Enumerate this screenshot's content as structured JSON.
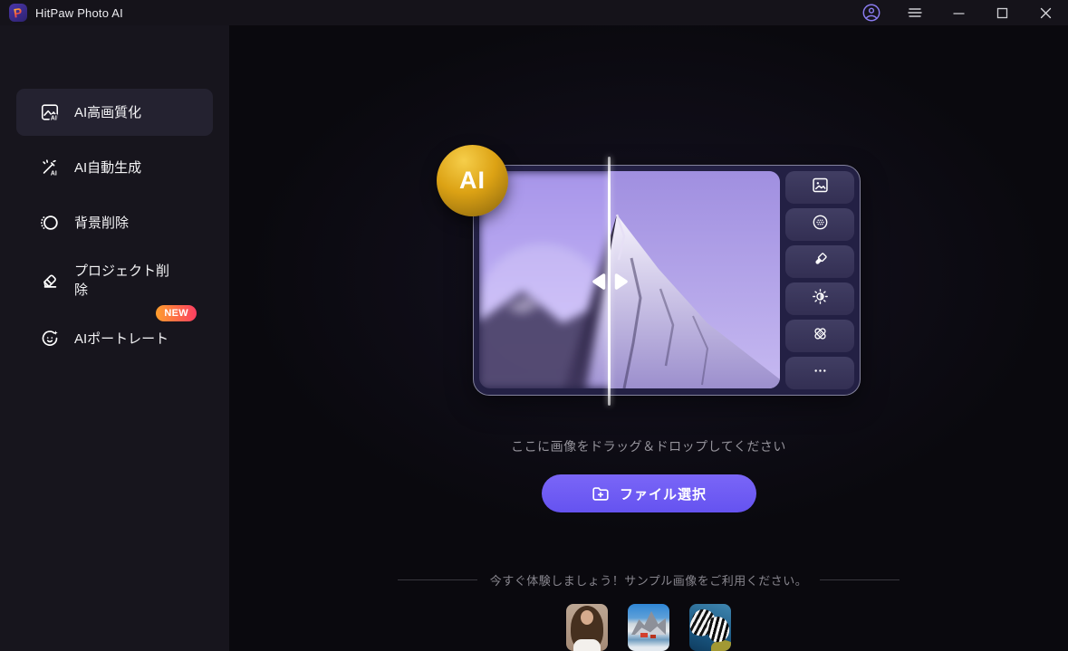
{
  "titlebar": {
    "app_title": "HitPaw Photo AI",
    "logo_letter": "P",
    "controls": [
      "account-icon",
      "menu-icon",
      "minimize",
      "maximize",
      "close"
    ]
  },
  "sidebar": {
    "items": [
      {
        "label": "AI高画質化",
        "icon": "ai-enhance-icon",
        "selected": true
      },
      {
        "label": "AI自動生成",
        "icon": "ai-generate-icon",
        "selected": false
      },
      {
        "label": "背景削除",
        "icon": "background-removal-icon",
        "selected": false
      },
      {
        "label": "プロジェクト削除",
        "icon": "object-eraser-icon",
        "selected": false
      },
      {
        "label": "AIポートレート",
        "icon": "ai-portrait-icon",
        "selected": false,
        "badge": "NEW"
      }
    ]
  },
  "main": {
    "hero": {
      "ai_badge_label": "AI",
      "toolbar_icons": [
        "image-icon",
        "denoise-icon",
        "colorize-brush-icon",
        "brightness-icon",
        "repair-patch-icon",
        "more-dots-icon"
      ],
      "description": "before-after-mountain-compare-illustration"
    },
    "drop_hint": "ここに画像をドラッグ＆ドロップしてください",
    "file_button_label": "ファイル選択",
    "sample_tip": "今すぐ体験しましょう！サンプル画像をご利用ください。",
    "samples": [
      "portrait-woman-sample",
      "snow-landscape-sample",
      "striped-fish-sample"
    ]
  },
  "colors": {
    "accent_purple": "#6e5bf5",
    "badge_gradient_start": "#ff9e2c",
    "badge_gradient_end": "#fb3e62",
    "ai_badge_gold": "#dca214",
    "sidebar_bg": "#17151d",
    "main_bg": "#0a090e",
    "selected_item_bg": "#242230"
  }
}
